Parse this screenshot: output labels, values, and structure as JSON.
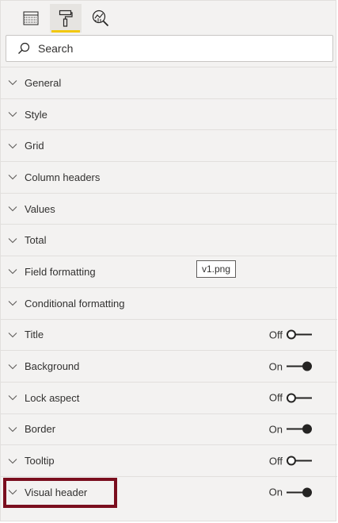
{
  "tabs": [
    {
      "name": "fields",
      "icon": "table-icon",
      "active": false
    },
    {
      "name": "format",
      "icon": "paint-roller-icon",
      "active": true
    },
    {
      "name": "analytics",
      "icon": "analytics-magnifier-icon",
      "active": false
    }
  ],
  "search": {
    "placeholder": "Search"
  },
  "sections": [
    {
      "label": "General"
    },
    {
      "label": "Style"
    },
    {
      "label": "Grid"
    },
    {
      "label": "Column headers"
    },
    {
      "label": "Values"
    },
    {
      "label": "Total"
    },
    {
      "label": "Field formatting"
    },
    {
      "label": "Conditional formatting"
    },
    {
      "label": "Title",
      "toggle": "Off"
    },
    {
      "label": "Background",
      "toggle": "On"
    },
    {
      "label": "Lock aspect",
      "toggle": "Off"
    },
    {
      "label": "Border",
      "toggle": "On"
    },
    {
      "label": "Tooltip",
      "toggle": "Off"
    },
    {
      "label": "Visual header",
      "toggle": "On"
    }
  ],
  "overlay_label": "v1.png",
  "colors": {
    "pane_bg": "#f3f2f1",
    "accent": "#f2c811",
    "highlight_border": "#7a0e1e"
  }
}
